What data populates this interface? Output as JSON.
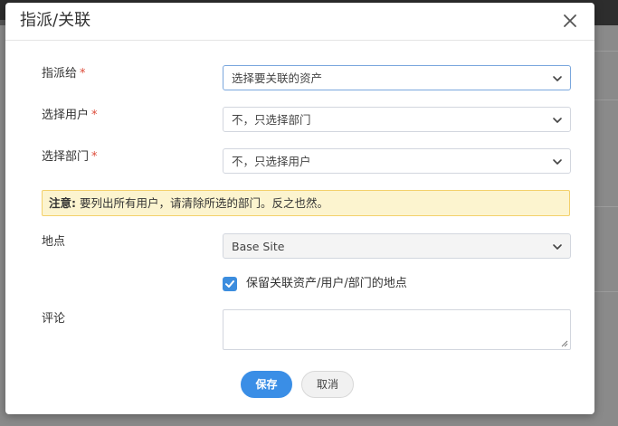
{
  "dialog": {
    "title": "指派/关联",
    "close_icon": "close-icon"
  },
  "form": {
    "assign_to": {
      "label": "指派给",
      "required_mark": "*",
      "value": "选择要关联的资产"
    },
    "select_user": {
      "label": "选择用户",
      "required_mark": "*",
      "value": "不，只选择部门"
    },
    "select_department": {
      "label": "选择部门",
      "required_mark": "*",
      "value": "不，只选择用户"
    },
    "notice": {
      "strong": "注意:",
      "text": " 要列出所有用户，请清除所选的部门。反之也然。"
    },
    "location": {
      "label": "地点",
      "value": "Base Site"
    },
    "keep_location": {
      "checked": true,
      "label": "保留关联资产/用户/部门的地点"
    },
    "comment": {
      "label": "评论",
      "value": ""
    }
  },
  "actions": {
    "save_label": "保存",
    "cancel_label": "取消"
  },
  "colors": {
    "primary": "#3a8ee6",
    "required": "#dd4b39",
    "notice_bg": "#fcf4cf",
    "notice_border": "#f3d06b"
  }
}
